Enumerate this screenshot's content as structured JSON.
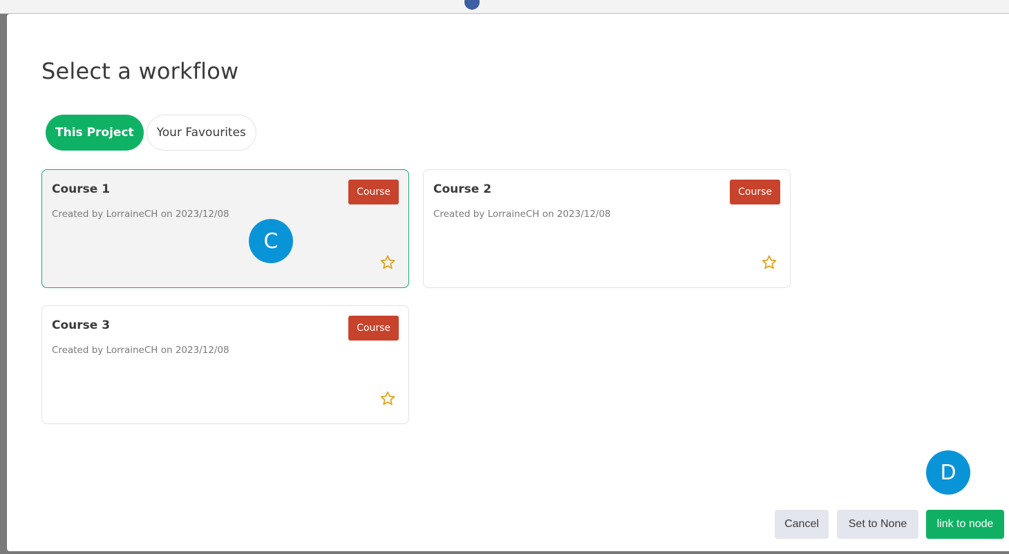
{
  "modal": {
    "title": "Select a workflow"
  },
  "tabs": [
    {
      "label": "This Project",
      "active": true
    },
    {
      "label": "Your Favourites",
      "active": false
    }
  ],
  "workflows": [
    {
      "title": "Course 1",
      "meta": "Created by LorraineCH on 2023/12/08",
      "type": "Course",
      "selected": true,
      "favourite": false
    },
    {
      "title": "Course 2",
      "meta": "Created by LorraineCH on 2023/12/08",
      "type": "Course",
      "selected": false,
      "favourite": false
    },
    {
      "title": "Course 3",
      "meta": "Created by LorraineCH on 2023/12/08",
      "type": "Course",
      "selected": false,
      "favourite": false
    }
  ],
  "annotations": {
    "c": "C",
    "d": "D"
  },
  "footer": {
    "cancel_label": "Cancel",
    "set_none_label": "Set to None",
    "link_label": "link to node"
  },
  "colors": {
    "accent_green": "#0fb264",
    "badge_red": "#c8432c",
    "star_gold": "#e3a21a",
    "marker_blue": "#0a94d8"
  }
}
